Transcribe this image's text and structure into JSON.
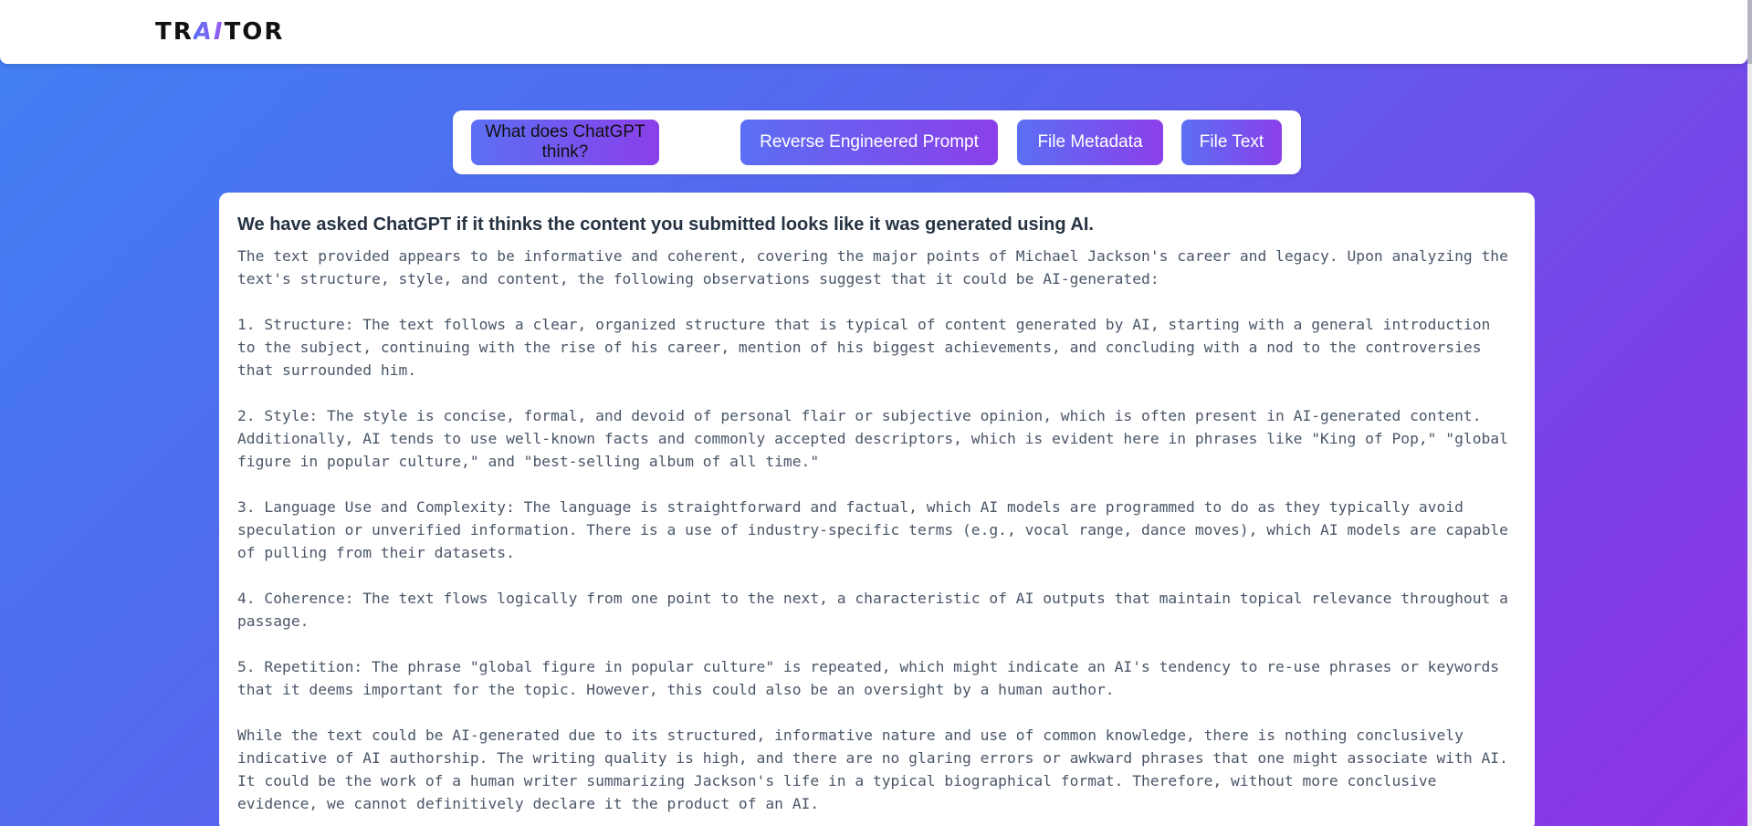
{
  "header": {
    "logo_left": "TR",
    "logo_ai": "AI",
    "logo_right": "TOR"
  },
  "tabs": [
    {
      "label": "What does ChatGPT think?",
      "active": true
    },
    {
      "label": "Reverse Engineered Prompt",
      "active": false
    },
    {
      "label": "File Metadata",
      "active": false
    },
    {
      "label": "File Text",
      "active": false
    }
  ],
  "result": {
    "title": "We have asked ChatGPT if it thinks the content you submitted looks like it was generated using AI.",
    "body": "The text provided appears to be informative and coherent, covering the major points of Michael Jackson's career and legacy. Upon analyzing the text's structure, style, and content, the following observations suggest that it could be AI-generated:\n\n1. Structure: The text follows a clear, organized structure that is typical of content generated by AI, starting with a general introduction to the subject, continuing with the rise of his career, mention of his biggest achievements, and concluding with a nod to the controversies that surrounded him.\n\n2. Style: The style is concise, formal, and devoid of personal flair or subjective opinion, which is often present in AI-generated content. Additionally, AI tends to use well-known facts and commonly accepted descriptors, which is evident here in phrases like \"King of Pop,\" \"global figure in popular culture,\" and \"best-selling album of all time.\"\n\n3. Language Use and Complexity: The language is straightforward and factual, which AI models are programmed to do as they typically avoid speculation or unverified information. There is a use of industry-specific terms (e.g., vocal range, dance moves), which AI models are capable of pulling from their datasets.\n\n4. Coherence: The text flows logically from one point to the next, a characteristic of AI outputs that maintain topical relevance throughout a passage.\n\n5. Repetition: The phrase \"global figure in popular culture\" is repeated, which might indicate an AI's tendency to re-use phrases or keywords that it deems important for the topic. However, this could also be an oversight by a human author.\n\nWhile the text could be AI-generated due to its structured, informative nature and use of common knowledge, there is nothing conclusively indicative of AI authorship. The writing quality is high, and there are no glaring errors or awkward phrases that one might associate with AI. It could be the work of a human writer summarizing Jackson's life in a typical biographical format. Therefore, without more conclusive evidence, we cannot definitively declare it the product of an AI."
  },
  "colors": {
    "background_start": "#3f80f2",
    "background_end": "#8f34e6",
    "button_start": "#5b6ff4",
    "button_end": "#8b3fe9",
    "title_text": "#263342",
    "body_text": "#4a5668"
  }
}
